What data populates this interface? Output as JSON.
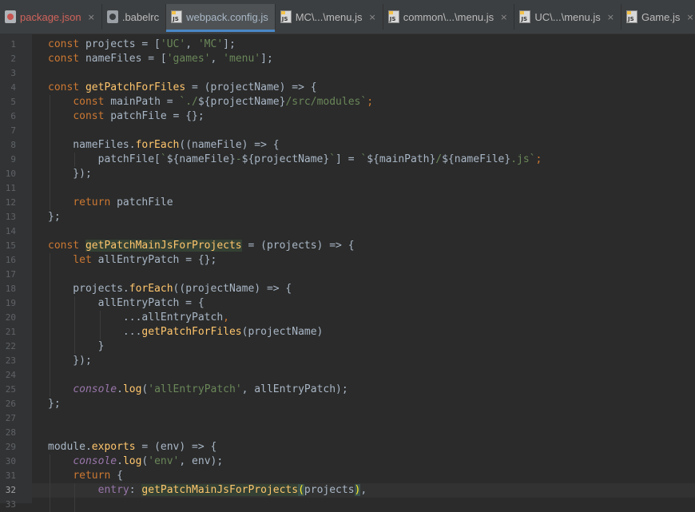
{
  "tabs": [
    {
      "label": "package.json",
      "icon": "json-file-icon",
      "active": false,
      "closable": true
    },
    {
      "label": ".babelrc",
      "icon": "config-file-icon",
      "active": false,
      "closable": false
    },
    {
      "label": "webpack.config.js",
      "icon": "js-file-icon",
      "active": true,
      "closable": false
    },
    {
      "label": "MC\\...\\menu.js",
      "icon": "js-file-icon",
      "active": false,
      "closable": true
    },
    {
      "label": "common\\...\\menu.js",
      "icon": "js-file-icon",
      "active": false,
      "closable": true
    },
    {
      "label": "UC\\...\\menu.js",
      "icon": "js-file-icon",
      "active": false,
      "closable": true
    },
    {
      "label": "Game.js",
      "icon": "js-file-icon",
      "active": false,
      "closable": true
    }
  ],
  "close_glyph": "×",
  "editor": {
    "current_line": 32,
    "line_numbers": [
      "1",
      "2",
      "3",
      "4",
      "5",
      "6",
      "7",
      "8",
      "9",
      "10",
      "11",
      "12",
      "13",
      "14",
      "15",
      "16",
      "17",
      "18",
      "19",
      "20",
      "21",
      "22",
      "23",
      "24",
      "25",
      "26",
      "27",
      "28",
      "29",
      "30",
      "31",
      "32",
      "33"
    ],
    "lines": [
      [
        [
          "kw",
          "const "
        ],
        [
          "plain",
          "projects = ["
        ],
        [
          "str",
          "'UC'"
        ],
        [
          "plain",
          ", "
        ],
        [
          "str",
          "'MC'"
        ],
        [
          "plain",
          "];"
        ]
      ],
      [
        [
          "kw",
          "const "
        ],
        [
          "plain",
          "nameFiles = ["
        ],
        [
          "str",
          "'games'"
        ],
        [
          "plain",
          ", "
        ],
        [
          "str",
          "'menu'"
        ],
        [
          "plain",
          "];"
        ]
      ],
      [],
      [
        [
          "kw",
          "const "
        ],
        [
          "fn",
          "getPatchForFiles"
        ],
        [
          "plain",
          " = (projectName) => {"
        ]
      ],
      [
        [
          "plain",
          "    "
        ],
        [
          "kw",
          "const "
        ],
        [
          "plain",
          "mainPath = "
        ],
        [
          "str",
          "`./"
        ],
        [
          "plain",
          "${projectName}"
        ],
        [
          "str",
          "/src/modules`"
        ],
        [
          "kw",
          ";"
        ]
      ],
      [
        [
          "plain",
          "    "
        ],
        [
          "kw",
          "const "
        ],
        [
          "plain",
          "patchFile = {};"
        ]
      ],
      [],
      [
        [
          "plain",
          "    nameFiles."
        ],
        [
          "fn",
          "forEach"
        ],
        [
          "plain",
          "((nameFile) => {"
        ]
      ],
      [
        [
          "plain",
          "        patchFile["
        ],
        [
          "str",
          "`"
        ],
        [
          "plain",
          "${nameFile}"
        ],
        [
          "str",
          "-"
        ],
        [
          "plain",
          "${projectName}"
        ],
        [
          "str",
          "`"
        ],
        [
          "plain",
          "] = "
        ],
        [
          "str",
          "`"
        ],
        [
          "plain",
          "${mainPath}"
        ],
        [
          "str",
          "/"
        ],
        [
          "plain",
          "${nameFile}"
        ],
        [
          "str",
          ".js`"
        ],
        [
          "kw",
          ";"
        ]
      ],
      [
        [
          "plain",
          "    });"
        ]
      ],
      [],
      [
        [
          "plain",
          "    "
        ],
        [
          "kw",
          "return "
        ],
        [
          "plain",
          "patchFile"
        ]
      ],
      [
        [
          "plain",
          "};"
        ]
      ],
      [],
      [
        [
          "kw",
          "const "
        ],
        [
          "def",
          "getPatchMainJsForProjects"
        ],
        [
          "plain",
          " = (projects) => {"
        ]
      ],
      [
        [
          "plain",
          "    "
        ],
        [
          "kw",
          "let "
        ],
        [
          "plain",
          "allEntryPatch = {};"
        ]
      ],
      [],
      [
        [
          "plain",
          "    projects."
        ],
        [
          "fn",
          "forEach"
        ],
        [
          "plain",
          "((projectName) => {"
        ]
      ],
      [
        [
          "plain",
          "        allEntryPatch = {"
        ]
      ],
      [
        [
          "plain",
          "            ...allEntryPatch"
        ],
        [
          "kw",
          ","
        ]
      ],
      [
        [
          "plain",
          "            ..."
        ],
        [
          "fn",
          "getPatchForFiles"
        ],
        [
          "plain",
          "(projectName)"
        ]
      ],
      [
        [
          "plain",
          "        }"
        ]
      ],
      [
        [
          "plain",
          "    });"
        ]
      ],
      [],
      [
        [
          "plain",
          "    "
        ],
        [
          "it",
          "console"
        ],
        [
          "plain",
          "."
        ],
        [
          "fn",
          "log"
        ],
        [
          "plain",
          "("
        ],
        [
          "str",
          "'allEntryPatch'"
        ],
        [
          "plain",
          ", allEntryPatch);"
        ]
      ],
      [
        [
          "plain",
          "};"
        ]
      ],
      [],
      [],
      [
        [
          "plain",
          "module."
        ],
        [
          "fn",
          "exports"
        ],
        [
          "plain",
          " = (env) => {"
        ]
      ],
      [
        [
          "plain",
          "    "
        ],
        [
          "it",
          "console"
        ],
        [
          "plain",
          "."
        ],
        [
          "fn",
          "log"
        ],
        [
          "plain",
          "("
        ],
        [
          "str",
          "'env'"
        ],
        [
          "plain",
          ", env);"
        ]
      ],
      [
        [
          "plain",
          "    "
        ],
        [
          "kw",
          "return "
        ],
        [
          "plain",
          "{"
        ]
      ],
      [
        [
          "plain",
          "        "
        ],
        [
          "prop",
          "entry"
        ],
        [
          "plain",
          ": "
        ],
        [
          "fnhl",
          "getPatchMainJsForProjects"
        ],
        [
          "brace-hl",
          "("
        ],
        [
          "plain",
          "projects"
        ],
        [
          "brace-hl",
          ")"
        ],
        [
          "plain",
          ","
        ]
      ],
      []
    ]
  },
  "colors": {
    "background": "#2b2b2b",
    "keyword": "#cc7832",
    "string": "#6a8759",
    "function": "#ffc66d",
    "plain": "#a9b7c6",
    "gutter_text": "#606366"
  }
}
